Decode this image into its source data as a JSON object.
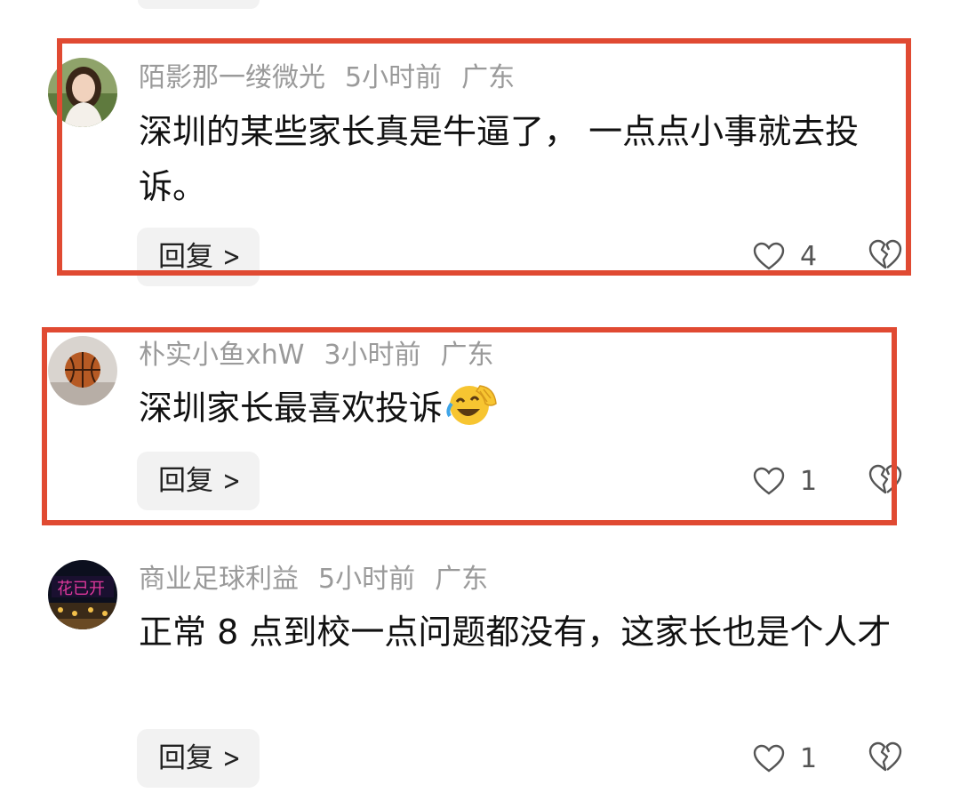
{
  "reply_label": "回复",
  "highlight_color": "#e04a32",
  "comments": [
    {
      "username": "陌影那一缕微光",
      "time": "5小时前",
      "location": "广东",
      "content": "深圳的某些家长真是牛逼了， 一点点小事就去投诉。",
      "likes": "4",
      "avatar_icon": "woman-portrait-avatar"
    },
    {
      "username": "朴实小鱼xhW",
      "time": "3小时前",
      "location": "广东",
      "content": "深圳家长最喜欢投诉",
      "emoji": "laughing-crying-emoji",
      "likes": "1",
      "avatar_icon": "basketball-avatar"
    },
    {
      "username": "商业足球利益",
      "time": "5小时前",
      "location": "广东",
      "content": "正常 8 点到校一点问题都没有，这家长也是个人才",
      "likes": "1",
      "avatar_icon": "night-city-avatar"
    }
  ]
}
